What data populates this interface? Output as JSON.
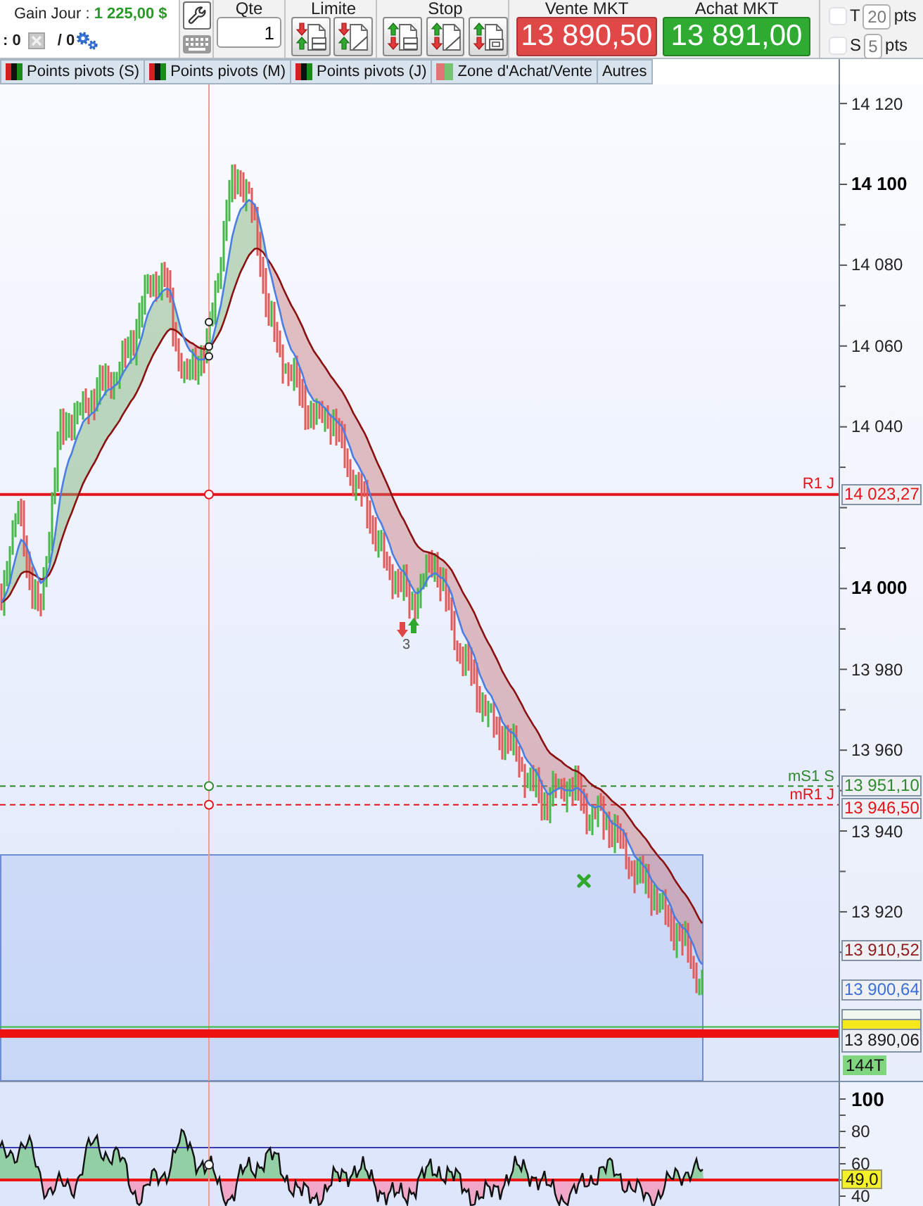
{
  "account": {
    "label": "Gain Jour :",
    "value": "1 225,00 $",
    "positions": ": 0",
    "orders": "/ 0"
  },
  "order_panel": {
    "quantity_label": "Qte",
    "quantity": "1",
    "limit_label": "Limite",
    "stop_label": "Stop",
    "market": [
      {
        "kind": "sell",
        "label": "Vente MKT",
        "price": "13 890,50"
      },
      {
        "kind": "buy",
        "label": "Achat MKT",
        "price": "13 891,00"
      }
    ],
    "offsets": [
      {
        "letter": "T",
        "checked": false,
        "disabled": true,
        "value": "20",
        "unit": "pts"
      },
      {
        "letter": "S",
        "checked": false,
        "disabled": true,
        "value": "5",
        "unit": "pts"
      }
    ]
  },
  "indicator_tabs": [
    {
      "kind": "pivot",
      "label": "Points pivots (S)"
    },
    {
      "kind": "pivot",
      "label": "Points pivots (M)"
    },
    {
      "kind": "pivot",
      "label": "Points pivots (J)"
    },
    {
      "kind": "zone",
      "label": "Zone d'Achat/Vente"
    },
    {
      "kind": "plain",
      "label": "Autres"
    }
  ],
  "price_chart": {
    "axis_labels": [
      {
        "label": "14 120",
        "major": false
      },
      {
        "label": "14 100",
        "major": true
      },
      {
        "label": "14 080",
        "major": false
      },
      {
        "label": "14 060",
        "major": false
      },
      {
        "label": "14 040",
        "major": false
      },
      {
        "label": "14 000",
        "major": true
      },
      {
        "label": "13 980",
        "major": false
      },
      {
        "label": "13 960",
        "major": false
      },
      {
        "label": "13 940",
        "major": false
      },
      {
        "label": "13 920",
        "major": false
      }
    ],
    "levels": [
      {
        "kind": "pivot",
        "label": "R1 J",
        "value": "14 023,27",
        "color": "#e4141b"
      },
      {
        "kind": "midpoint",
        "label": "mS1 S",
        "value": "13 951,10",
        "color": "#2f8a2f"
      },
      {
        "kind": "midpoint",
        "label": "mR1 J",
        "value": "13 946,50",
        "color": "#e4141b"
      }
    ],
    "tags": [
      {
        "kind": "average",
        "value": "13 910,52",
        "color": "#8e1b1b"
      },
      {
        "kind": "average",
        "value": "13 900,64",
        "color": "#3c6fd6"
      },
      {
        "kind": "last",
        "value": "13 890,06",
        "color": "#1a1a1a"
      }
    ],
    "tick_count": "144T",
    "signal_count": "3"
  },
  "oscillator": {
    "axis_labels": [
      {
        "label": "100",
        "major": true
      },
      {
        "label": "80",
        "major": false
      },
      {
        "label": "60",
        "major": false
      },
      {
        "label": "40",
        "major": false
      }
    ],
    "value": "49,0"
  }
}
